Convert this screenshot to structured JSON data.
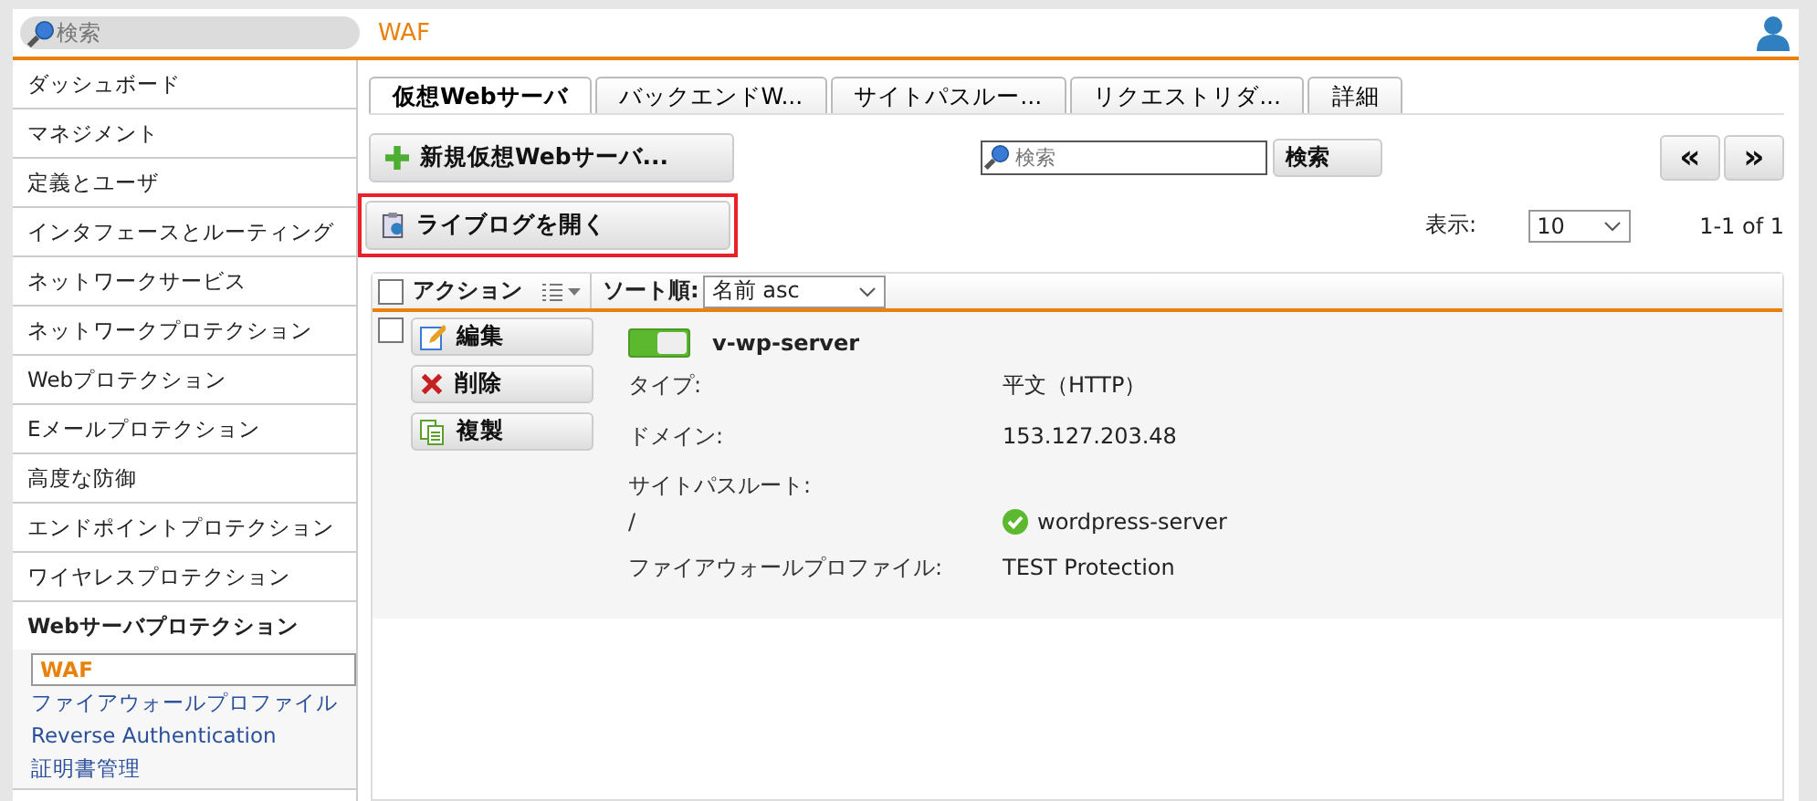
{
  "top_bar": {
    "search_placeholder": "検索",
    "title": "WAF"
  },
  "sidebar": {
    "items": [
      {
        "label": "ダッシュボード",
        "expanded": false
      },
      {
        "label": "マネジメント",
        "expanded": false
      },
      {
        "label": "定義とユーザ",
        "expanded": false
      },
      {
        "label": "インタフェースとルーティング",
        "expanded": false
      },
      {
        "label": "ネットワークサービス",
        "expanded": false
      },
      {
        "label": "ネットワークプロテクション",
        "expanded": false
      },
      {
        "label": "Webプロテクション",
        "expanded": false
      },
      {
        "label": "Eメールプロテクション",
        "expanded": false
      },
      {
        "label": "高度な防御",
        "expanded": false
      },
      {
        "label": "エンドポイントプロテクション",
        "expanded": false
      },
      {
        "label": "ワイヤレスプロテクション",
        "expanded": false
      },
      {
        "label": "Webサーバプロテクション",
        "expanded": true,
        "children": [
          {
            "label": "WAF",
            "selected": true
          },
          {
            "label": "ファイアウォールプロファイル",
            "selected": false
          },
          {
            "label": "Reverse Authentication",
            "selected": false
          },
          {
            "label": "証明書管理",
            "selected": false
          }
        ]
      }
    ]
  },
  "tabs": [
    {
      "label": "仮想Webサーバ",
      "selected": true
    },
    {
      "label": "バックエンドW...",
      "selected": false
    },
    {
      "label": "サイトパスルー...",
      "selected": false
    },
    {
      "label": "リクエストリダ...",
      "selected": false
    },
    {
      "label": "詳細",
      "selected": false
    }
  ],
  "toolbar": {
    "new_button": "新規仮想Webサーバ...",
    "search_placeholder": "検索",
    "search_button": "検索",
    "prev_button": "«",
    "next_button": "»",
    "live_log_button": "ライブログを開く",
    "live_log_highlighted": true,
    "display_label": "表示:",
    "page_size": "10",
    "count": "1-1 of 1"
  },
  "table": {
    "select_all_checked": false,
    "actions_label": "アクション",
    "sort_label": "ソート順:",
    "sort_value": "名前 asc",
    "rows": [
      {
        "checked": false,
        "enabled": true,
        "name": "v-wp-server",
        "actions": [
          {
            "kind": "edit",
            "label": "編集"
          },
          {
            "kind": "delete",
            "label": "削除"
          },
          {
            "kind": "copy",
            "label": "複製"
          }
        ],
        "fields": [
          {
            "kind": "text",
            "label": "タイプ:",
            "value": "平文（HTTP）"
          },
          {
            "kind": "text",
            "label": "ドメイン:",
            "value": "153.127.203.48"
          },
          {
            "kind": "path",
            "label": "サイトパスルート:",
            "path": "/",
            "value": "wordpress-server"
          },
          {
            "kind": "text",
            "label": "ファイアウォールプロファイル:",
            "value": "TEST Protection"
          }
        ]
      }
    ]
  }
}
